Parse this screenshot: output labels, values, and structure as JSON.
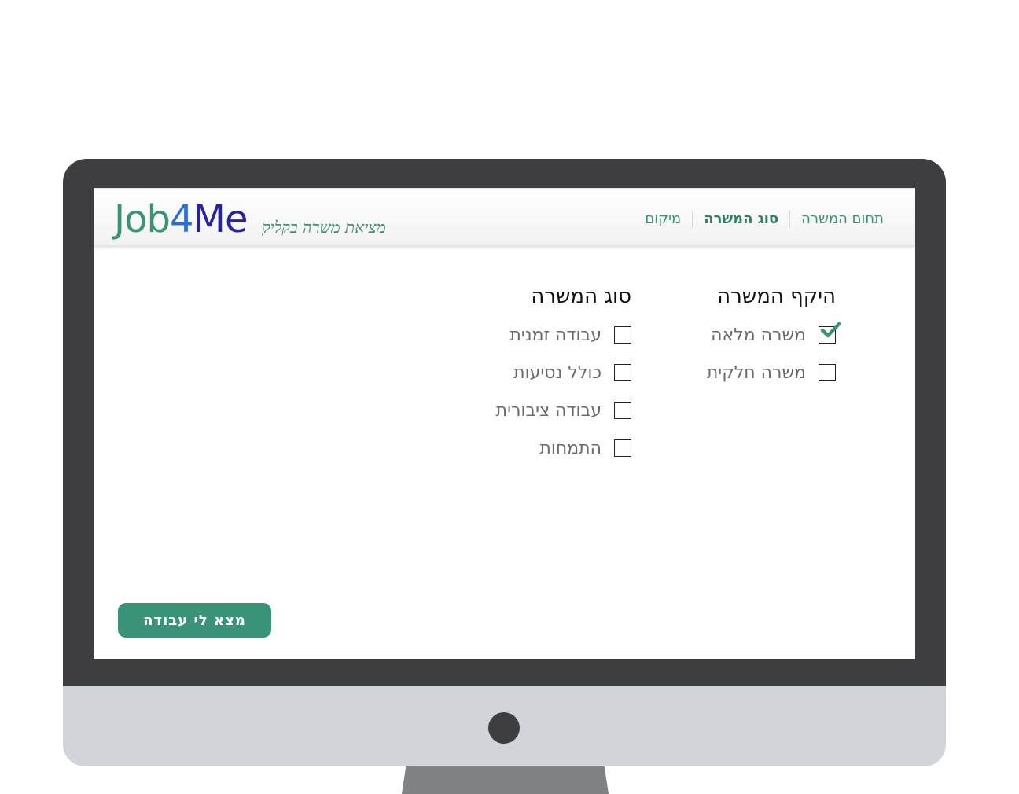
{
  "brand": {
    "logo_part1": "Job",
    "logo_part2": "4",
    "logo_part3": "Me",
    "tagline": "מציאת משרה בקליק",
    "colors": {
      "green": "#3a9378",
      "blue": "#2a6fd6",
      "navy": "#28239c",
      "bezel": "#3e3e40",
      "chin": "#d1d5da"
    }
  },
  "nav": {
    "items": [
      {
        "label": "תחום המשרה",
        "active": false
      },
      {
        "label": "סוג המשרה",
        "active": true
      },
      {
        "label": "מיקום",
        "active": false
      }
    ]
  },
  "scope": {
    "title": "היקף המשרה",
    "options": [
      {
        "label": "משרה מלאה",
        "checked": true
      },
      {
        "label": "משרה חלקית",
        "checked": false
      }
    ]
  },
  "type": {
    "title": "סוג המשרה",
    "options": [
      {
        "label": "עבודה זמנית",
        "checked": false
      },
      {
        "label": "כולל נסיעות",
        "checked": false
      },
      {
        "label": "עבודה ציבורית",
        "checked": false
      },
      {
        "label": "התמחות",
        "checked": false
      }
    ]
  },
  "cta": {
    "label": "מצא לי עבודה"
  },
  "icons": {
    "check": "check-icon"
  }
}
